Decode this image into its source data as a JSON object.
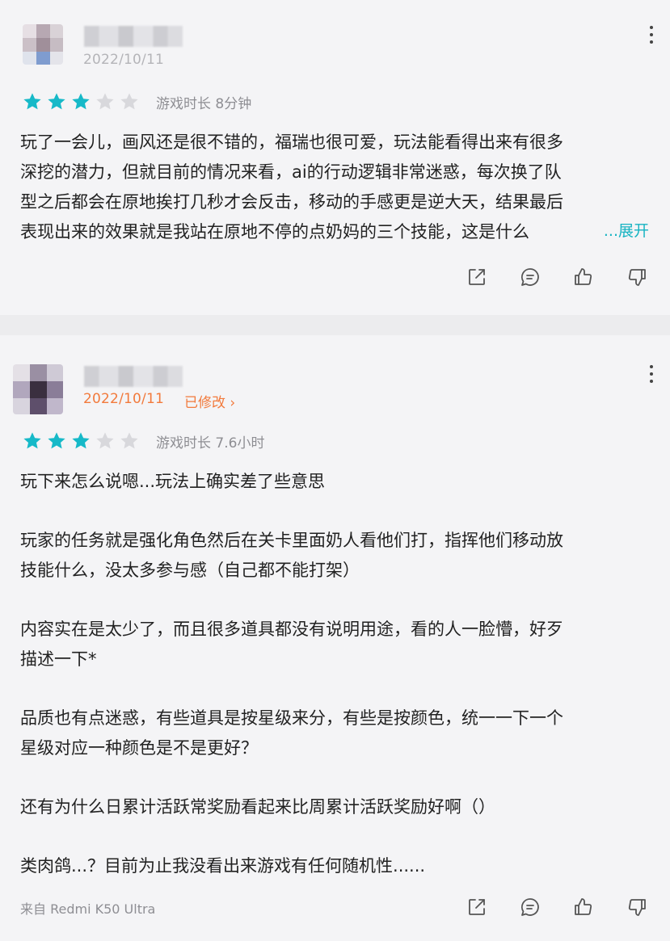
{
  "reviews": [
    {
      "date": "2022/10/11",
      "rating": 3,
      "max_rating": 5,
      "playtime": "游戏时长 8分钟",
      "lines": [
        "玩了一会儿，画风还是很不错的，福瑞也很可爱，玩法能看得出来有很多",
        "深挖的潜力，但就目前的情况来看，ai的行动逻辑非常迷惑，每次换了队",
        "型之后都会在原地挨打几秒才会反击，移动的手感更是逆大天，结果最后",
        "表现出来的效果就是我站在原地不停的点奶妈的三个技能，这是什么"
      ],
      "expand_label": "...展开"
    },
    {
      "date": "2022/10/11",
      "edited_label": "已修改 ›",
      "rating": 3,
      "max_rating": 5,
      "playtime": "游戏时长 7.6小时",
      "paragraphs": [
        "玩下来怎么说嗯...玩法上确实差了些意思",
        "玩家的任务就是强化角色然后在关卡里面奶人看他们打，指挥他们移动放",
        "技能什么，没太多参与感（自己都不能打架）",
        "内容实在是太少了，而且很多道具都没有说明用途，看的人一脸懵，好歹",
        "描述一下*",
        "品质也有点迷惑，有些道具是按星级来分，有些是按颜色，统一一下一个",
        "星级对应一种颜色是不是更好？",
        "还有为什么日累计活跃常奖励看起来比周累计活跃奖励好啊（）",
        "类肉鸽...？目前为止我没看出来游戏有任何随机性......"
      ],
      "source": "来自 Redmi K50 Ultra"
    }
  ],
  "colors": {
    "star_filled": "#16b9c8",
    "star_empty": "#d8d8dc",
    "accent_orange": "#f27a3c",
    "expand_link": "#16b3c2"
  },
  "icons": [
    "more-icon",
    "star-icon",
    "share-icon",
    "comment-icon",
    "thumbs-up-icon",
    "thumbs-down-icon"
  ]
}
